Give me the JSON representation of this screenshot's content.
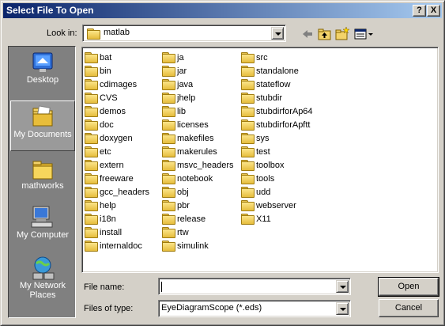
{
  "window": {
    "title": "Select File To Open",
    "help_button": "?",
    "close_button": "X"
  },
  "look_in": {
    "label": "Look in:",
    "value": "matlab"
  },
  "places": [
    {
      "label": "Desktop",
      "icon": "desktop-icon"
    },
    {
      "label": "My Documents",
      "icon": "my-documents-icon"
    },
    {
      "label": "mathworks",
      "icon": "folder-icon"
    },
    {
      "label": "My Computer",
      "icon": "my-computer-icon"
    },
    {
      "label": "My Network Places",
      "icon": "network-places-icon"
    }
  ],
  "files": {
    "col1": [
      "bat",
      "bin",
      "cdimages",
      "CVS",
      "demos",
      "doc",
      "doxygen",
      "etc",
      "extern",
      "freeware",
      "gcc_headers",
      "help",
      "i18n",
      "install",
      "internaldoc"
    ],
    "col2": [
      "ja",
      "jar",
      "java",
      "jhelp",
      "lib",
      "licenses",
      "makefiles",
      "makerules",
      "msvc_headers",
      "notebook",
      "obj",
      "pbr",
      "release",
      "rtw",
      "simulink"
    ],
    "col3": [
      "src",
      "standalone",
      "stateflow",
      "stubdir",
      "stubdirforAp64",
      "stubdirforApftt",
      "sys",
      "test",
      "toolbox",
      "tools",
      "udd",
      "webserver",
      "X11"
    ]
  },
  "file_name": {
    "label": "File name:",
    "value": ""
  },
  "file_type": {
    "label": "Files of type:",
    "value": "EyeDiagramScope (*.eds)"
  },
  "buttons": {
    "open": "Open",
    "cancel": "Cancel"
  }
}
